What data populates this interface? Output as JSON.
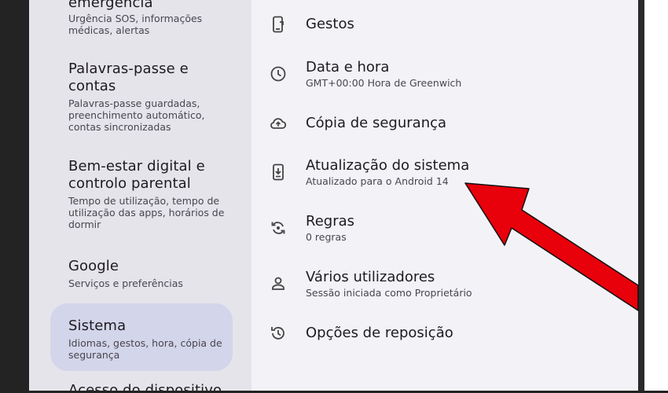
{
  "left_menu": {
    "items": [
      {
        "title": "emergência",
        "subtitle": "Urgência SOS, informações médicas, alertas"
      },
      {
        "title": "Palavras-passe e contas",
        "subtitle": "Palavras-passe guardadas, preenchimento automático, contas sincronizadas"
      },
      {
        "title": "Bem-estar digital e controlo parental",
        "subtitle": "Tempo de utilização, tempo de utilização das apps, horários de dormir"
      },
      {
        "title": "Google",
        "subtitle": "Serviços e preferências"
      },
      {
        "title": "Sistema",
        "subtitle": "Idiomas, gestos, hora, cópia de segurança"
      },
      {
        "title": "Acesso do dispositivo",
        "subtitle": ""
      }
    ],
    "selected": "Sistema"
  },
  "system_menu": {
    "items": [
      {
        "title": "Gestos",
        "subtitle": "",
        "icon": "gestures-icon"
      },
      {
        "title": "Data e hora",
        "subtitle": "GMT+00:00 Hora de Greenwich",
        "icon": "clock-icon"
      },
      {
        "title": "Cópia de segurança",
        "subtitle": "",
        "icon": "cloud-upload-icon"
      },
      {
        "title": "Atualização do sistema",
        "subtitle": "Atualizado para o Android 14",
        "icon": "system-update-icon"
      },
      {
        "title": "Regras",
        "subtitle": "0 regras",
        "icon": "rules-icon"
      },
      {
        "title": "Vários utilizadores",
        "subtitle": "Sessão iniciada como Proprietário",
        "icon": "person-icon"
      },
      {
        "title": "Opções de reposição",
        "subtitle": "",
        "icon": "history-icon"
      }
    ]
  },
  "annotation": {
    "arrow_color": "#e8000b",
    "points_to": "Atualização do sistema"
  },
  "colors": {
    "left_bg": "#e5e4ea",
    "right_bg": "#f3f2f7",
    "selected_bg": "#d3d5ea"
  }
}
